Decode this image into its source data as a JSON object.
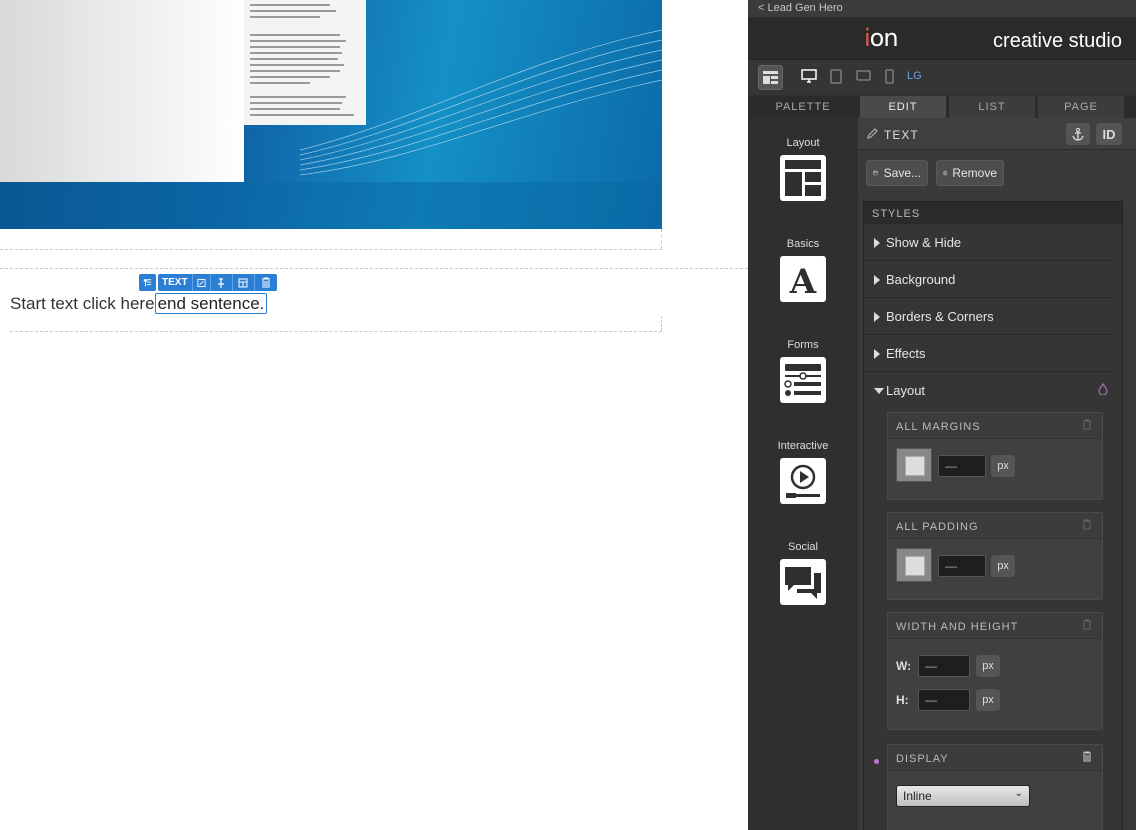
{
  "canvas": {
    "text_block": {
      "start": "Start text ",
      "link": "click here",
      "selected": "end sentence."
    },
    "toolbar": {
      "label": "TEXT"
    }
  },
  "panel": {
    "back_link": "< Lead Gen Hero",
    "brand": {
      "logo_text": "on",
      "logo_i": "i",
      "studio": "creative studio"
    },
    "device_label": "LG",
    "tabs": [
      {
        "label": "PALETTE"
      },
      {
        "label": "EDIT"
      },
      {
        "label": "LIST"
      },
      {
        "label": "PAGE"
      }
    ],
    "palette": [
      {
        "label": "Layout"
      },
      {
        "label": "Basics"
      },
      {
        "label": "Forms"
      },
      {
        "label": "Interactive"
      },
      {
        "label": "Social"
      }
    ],
    "editor": {
      "title": "TEXT",
      "id_label": "ID",
      "save_label": "Save...",
      "remove_label": "Remove",
      "styles_label": "STYLES",
      "sections": [
        {
          "label": "Show & Hide"
        },
        {
          "label": "Background"
        },
        {
          "label": "Borders & Corners"
        },
        {
          "label": "Effects"
        },
        {
          "label": "Layout"
        }
      ],
      "margins": {
        "title": "ALL MARGINS",
        "value": "—",
        "unit": "px"
      },
      "padding": {
        "title": "ALL PADDING",
        "value": "—",
        "unit": "px"
      },
      "size": {
        "title": "WIDTH AND HEIGHT",
        "w_label": "W:",
        "h_label": "H:",
        "w_value": "—",
        "h_value": "—",
        "unit": "px"
      },
      "display": {
        "title": "DISPLAY",
        "value": "Inline"
      }
    }
  }
}
